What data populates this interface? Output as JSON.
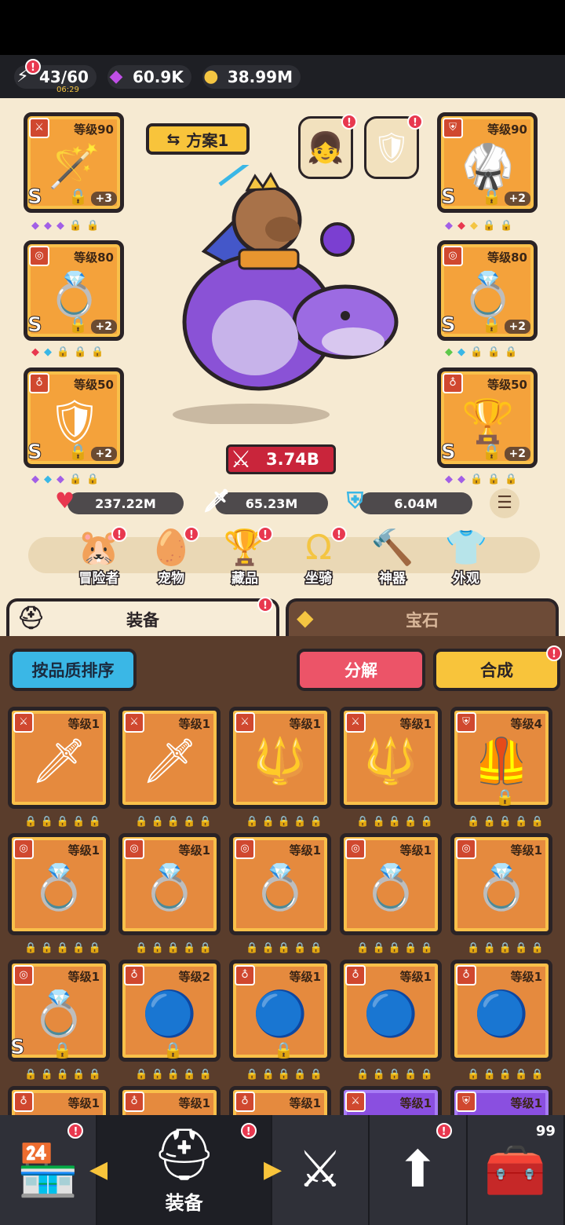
{
  "resources": {
    "energy": {
      "value": "43/60",
      "timer": "06:29"
    },
    "gems": {
      "value": "60.9K"
    },
    "gold": {
      "value": "38.99M"
    }
  },
  "loadout": {
    "plan_label": "方案1",
    "combat_power": "3.74B",
    "stats": {
      "hp": "237.22M",
      "attack": "65.23M",
      "defense": "6.04M"
    },
    "slots_left": [
      {
        "level": "等级90",
        "grade": "S",
        "plus": "+3",
        "icon": "wand-icon"
      },
      {
        "level": "等级80",
        "grade": "S",
        "plus": "+2",
        "icon": "ring-icon"
      },
      {
        "level": "等级50",
        "grade": "S",
        "plus": "+2",
        "icon": "amulet-icon"
      }
    ],
    "slots_right": [
      {
        "level": "等级90",
        "grade": "S",
        "plus": "+2",
        "icon": "armor-icon"
      },
      {
        "level": "等级80",
        "grade": "S",
        "plus": "+2",
        "icon": "ring-icon"
      },
      {
        "level": "等级50",
        "grade": "S",
        "plus": "+2",
        "icon": "chalice-icon"
      }
    ]
  },
  "features": [
    {
      "label": "冒险者",
      "icon": "capybara-icon"
    },
    {
      "label": "宠物",
      "icon": "egg-icon"
    },
    {
      "label": "藏品",
      "icon": "trophy-icon"
    },
    {
      "label": "坐骑",
      "icon": "horseshoe-icon"
    },
    {
      "label": "神器",
      "icon": "hammer-icon"
    },
    {
      "label": "外观",
      "icon": "outfit-icon"
    }
  ],
  "tabs": {
    "equipment": "装备",
    "gems": "宝石"
  },
  "actions": {
    "sort": "按品质排序",
    "decompose": "分解",
    "merge": "合成"
  },
  "inventory": [
    {
      "level": "等级1",
      "icon": "sword-icon",
      "emoji": "🗡"
    },
    {
      "level": "等级1",
      "icon": "sword-icon",
      "emoji": "🗡"
    },
    {
      "level": "等级1",
      "icon": "staff-icon",
      "emoji": "🔱"
    },
    {
      "level": "等级1",
      "icon": "staff-icon",
      "emoji": "🔱"
    },
    {
      "level": "等级4",
      "icon": "armor-icon",
      "emoji": "🦺"
    },
    {
      "level": "等级1",
      "icon": "ring-icon",
      "emoji": "💍"
    },
    {
      "level": "等级1",
      "icon": "ring-icon",
      "emoji": "💍"
    },
    {
      "level": "等级1",
      "icon": "ring-icon",
      "emoji": "💍"
    },
    {
      "level": "等级1",
      "icon": "ring-icon",
      "emoji": "💍"
    },
    {
      "level": "等级1",
      "icon": "ring-icon",
      "emoji": "💍"
    },
    {
      "level": "等级1",
      "icon": "ring-icon",
      "emoji": "💍"
    },
    {
      "level": "等级2",
      "icon": "orb-amulet-icon",
      "emoji": "🔵"
    },
    {
      "level": "等级1",
      "icon": "orb-amulet-icon",
      "emoji": "🔵"
    },
    {
      "level": "等级1",
      "icon": "orb-amulet-icon",
      "emoji": "🔵"
    },
    {
      "level": "等级1",
      "icon": "orb-amulet-icon",
      "emoji": "🔵"
    },
    {
      "level": "等级1",
      "icon": "amulet-icon",
      "emoji": ""
    },
    {
      "level": "等级1",
      "icon": "amulet-icon",
      "emoji": ""
    },
    {
      "level": "等级1",
      "icon": "amulet-icon",
      "emoji": ""
    },
    {
      "level": "等级1",
      "icon": "sword-icon",
      "emoji": ""
    },
    {
      "level": "等级1",
      "icon": "armor-icon",
      "emoji": ""
    }
  ],
  "nav": {
    "equipment_label": "装备",
    "chest_count": "99"
  }
}
